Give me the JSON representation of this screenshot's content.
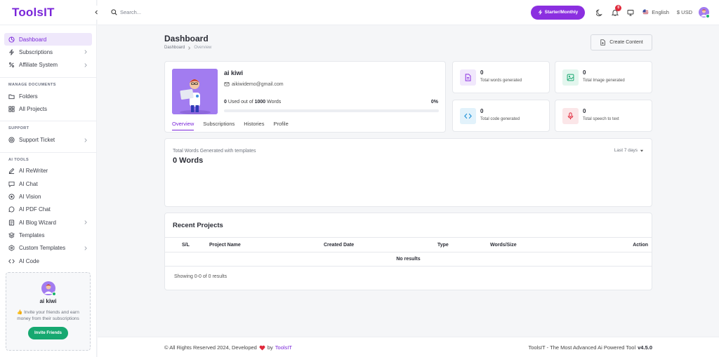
{
  "app": {
    "logo": "ToolsIT"
  },
  "topbar": {
    "search_placeholder": "Search...",
    "plan_label": "Starter/Monthly",
    "notification_count": "0",
    "language": "English",
    "currency": "$ USD"
  },
  "sidebar": {
    "items": [
      {
        "label": "Dashboard",
        "icon": "dashboard-icon"
      },
      {
        "label": "Subscriptions",
        "icon": "bolt-icon"
      },
      {
        "label": "Affiliate System",
        "icon": "percent-icon"
      }
    ],
    "section_manage": "MANAGE DOCUMENTS",
    "manage_items": [
      {
        "label": "Folders",
        "icon": "folder-icon"
      },
      {
        "label": "All Projects",
        "icon": "grid-icon"
      }
    ],
    "section_support": "SUPPORT",
    "support_items": [
      {
        "label": "Support Ticket",
        "icon": "lifebuoy-icon"
      }
    ],
    "section_ai": "AI TOOLS",
    "ai_items": [
      {
        "label": "AI ReWriter",
        "icon": "pen-icon"
      },
      {
        "label": "AI Chat",
        "icon": "chat-icon"
      },
      {
        "label": "AI Vision",
        "icon": "vision-icon"
      },
      {
        "label": "AI PDF Chat",
        "icon": "pdf-chat-icon"
      },
      {
        "label": "AI Blog Wizard",
        "icon": "blog-icon"
      },
      {
        "label": "Templates",
        "icon": "layers-icon"
      },
      {
        "label": "Custom Templates",
        "icon": "custom-template-icon"
      },
      {
        "label": "AI Code",
        "icon": "code-icon"
      }
    ],
    "invite": {
      "name": "ai kiwi",
      "emoji": "👍",
      "text": "Invite your friends and earn money from their subscriptions",
      "button": "Invite Friends"
    }
  },
  "dashboard": {
    "title": "Dashboard",
    "breadcrumb": [
      "Dashboard",
      "Overview"
    ],
    "create_button": "Create Content",
    "profile": {
      "name": "ai kiwi",
      "email": "aikiwidemo@gmail.com",
      "used_prefix": "0",
      "used_middle": "Used out of",
      "used_total": "1000",
      "used_suffix": "Words",
      "percent": "0%",
      "progress_fraction": 0,
      "tabs": [
        "Overview",
        "Subscriptions",
        "Histories",
        "Profile"
      ]
    },
    "stats": [
      {
        "value": "0",
        "label": "Total words generated",
        "icon": "document-icon",
        "color": "#8b2fe0",
        "bg": "#f1e8fc"
      },
      {
        "value": "0",
        "label": "Total Image generated",
        "icon": "image-icon",
        "color": "#18a870",
        "bg": "#e3f6ee"
      },
      {
        "value": "0",
        "label": "Total code generated",
        "icon": "code-icon",
        "color": "#1a8fd6",
        "bg": "#e2f2fb"
      },
      {
        "value": "0",
        "label": "Total speech to text",
        "icon": "mic-icon",
        "color": "#e0293b",
        "bg": "#fbe6e8"
      }
    ],
    "words_chart": {
      "title": "Total Words Generated with templates",
      "value": "0 Words",
      "range": "Last 7 days"
    },
    "projects": {
      "title": "Recent Projects",
      "columns": [
        "S/L",
        "Project Name",
        "Created Date",
        "Type",
        "Words/Size",
        "Action"
      ],
      "empty": "No results",
      "showing": "Showing 0-0 of 0 results"
    }
  },
  "footer": {
    "left_text": "© All Rights Reserved 2024, Developed",
    "by": "by",
    "brand": "ToolsIT",
    "right_text": "ToolsIT - The Most Advanced Ai Powered Tool",
    "version": "v4.5.0"
  },
  "colors": {
    "accent": "#8b2fe0",
    "success": "#16a870",
    "danger": "#e0293b"
  }
}
